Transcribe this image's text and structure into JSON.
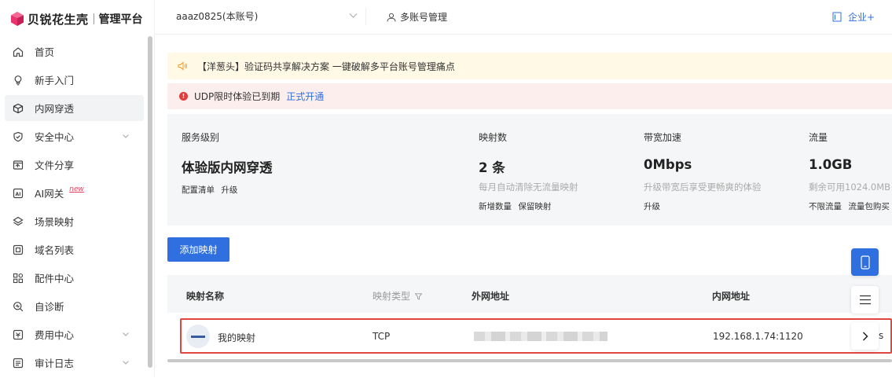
{
  "brand": {
    "name": "贝锐花生壳",
    "subtitle": "管理平台",
    "colors": {
      "logo": "#e8336e",
      "accent": "#2f6fe0",
      "danger": "#e23b3b"
    }
  },
  "sidebar": {
    "items": [
      {
        "label": "首页",
        "icon": "home-icon"
      },
      {
        "label": "新手入门",
        "icon": "lightbulb-icon"
      },
      {
        "label": "内网穿透",
        "icon": "cube-icon",
        "active": true
      },
      {
        "label": "安全中心",
        "icon": "shield-check-icon",
        "expandable": true
      },
      {
        "label": "文件分享",
        "icon": "folder-share-icon"
      },
      {
        "label": "AI网关",
        "icon": "ai-icon",
        "badge": "new"
      },
      {
        "label": "场景映射",
        "icon": "scene-icon"
      },
      {
        "label": "域名列表",
        "icon": "domain-icon"
      },
      {
        "label": "配件中心",
        "icon": "grid-icon"
      },
      {
        "label": "自诊断",
        "icon": "diagnose-icon"
      },
      {
        "label": "费用中心",
        "icon": "billing-icon",
        "expandable": true
      },
      {
        "label": "审计日志",
        "icon": "log-icon",
        "expandable": true
      }
    ]
  },
  "header": {
    "account": "aaaz0825(本账号)",
    "multi_account": "多账号管理",
    "enterprise": "企业+"
  },
  "banners": {
    "notice": "【洋葱头】验证码共享解决方案 一键破解多平台账号管理痛点",
    "udp_text": "UDP限时体验已到期",
    "udp_link": "正式开通"
  },
  "stats": {
    "service": {
      "title": "服务级别",
      "value": "体验版内网穿透",
      "links": [
        "配置清单",
        "升级"
      ]
    },
    "mappings": {
      "title": "映射数",
      "value": "2 条",
      "desc": "每月自动清除无流量映射",
      "links": [
        "新增数量",
        "保留映射"
      ]
    },
    "bandwidth": {
      "title": "带宽加速",
      "value": "0Mbps",
      "desc": "升级带宽后享受更畅爽的体验",
      "links": [
        "升级"
      ]
    },
    "traffic": {
      "title": "流量",
      "value": "1.0GB",
      "desc": "剩余可用1024.0MB",
      "links": [
        "不限流量",
        "流量包购买"
      ]
    }
  },
  "toolbar": {
    "add_label": "添加映射"
  },
  "table": {
    "headers": {
      "name": "映射名称",
      "type": "映射类型",
      "external": "外网地址",
      "internal": "内网地址"
    },
    "rows": [
      {
        "name": "我的映射",
        "type": "TCP",
        "internal": "192.168.1.74:1120",
        "tail": "s"
      }
    ]
  }
}
